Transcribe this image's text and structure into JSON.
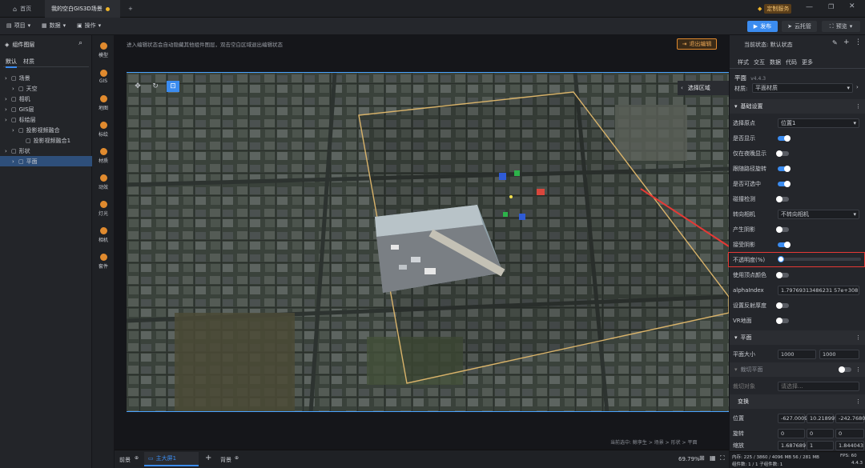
{
  "titlebar": {
    "home_tab": "首页",
    "doc_tab": "我的空白GIS3D场景",
    "custom_service": "定制服务"
  },
  "menubar": {
    "project": "项目",
    "data": "数据",
    "ops": "操作",
    "publish": "发布",
    "cloud": "云托管",
    "preview": "预览"
  },
  "left": {
    "title": "组件图层",
    "tab_default": "默认",
    "tab_material": "材质",
    "tree": [
      {
        "label": "场景",
        "depth": 0
      },
      {
        "label": "天空",
        "depth": 1
      },
      {
        "label": "相机",
        "depth": 0
      },
      {
        "label": "GIS层",
        "depth": 0
      },
      {
        "label": "标绘层",
        "depth": 0
      },
      {
        "label": "投影视频融合",
        "depth": 1
      },
      {
        "label": "投影视频融合1",
        "depth": 2
      },
      {
        "label": "形状",
        "depth": 0
      },
      {
        "label": "平面",
        "depth": 1
      }
    ]
  },
  "tools": [
    "模型",
    "GIS",
    "地图",
    "标绘",
    "材质",
    "动效",
    "灯光",
    "相机",
    "套件"
  ],
  "center": {
    "hint": "进入编辑状态会自动隐藏其他组件图层，双击空白区域退出编辑状态",
    "exit_edit": "退出编辑",
    "select_area": "选择区域",
    "breadcrumb": "当前选中: 鲸孪生 > 场景 > 形状 > 平面"
  },
  "right": {
    "status_label": "当前状态:",
    "status_value": "默认状态",
    "tabs": [
      "样式",
      "交互",
      "数据",
      "代码",
      "更多"
    ],
    "comp_name": "平面",
    "version": "v4.4.3",
    "material_label": "材质:",
    "material_value": "平面材质",
    "basic_section": "基础设置",
    "rows": [
      {
        "label": "选择原点",
        "type": "select",
        "value": "位置1"
      },
      {
        "label": "是否显示",
        "type": "toggle",
        "on": true
      },
      {
        "label": "仅在夜晚显示",
        "type": "toggle",
        "on": false
      },
      {
        "label": "跟随路径旋转",
        "type": "toggle",
        "on": true
      },
      {
        "label": "是否可选中",
        "type": "toggle",
        "on": true
      },
      {
        "label": "碰撞检测",
        "type": "toggle",
        "on": false
      },
      {
        "label": "转向相机",
        "type": "select",
        "value": "不转向相机"
      },
      {
        "label": "产生阴影",
        "type": "toggle",
        "on": false
      },
      {
        "label": "接受阴影",
        "type": "toggle",
        "on": true
      },
      {
        "label": "不透明度(%)",
        "type": "slider",
        "value": 0
      },
      {
        "label": "使用顶点颜色",
        "type": "toggle",
        "on": false
      },
      {
        "label": "alphaIndex",
        "type": "input",
        "value": "1.79769313486231 57e+308"
      },
      {
        "label": "设置反射厚度",
        "type": "toggle",
        "on": false
      },
      {
        "label": "VR地面",
        "type": "toggle",
        "on": false
      }
    ],
    "plane_section": "平面",
    "plane_size_label": "平面大小",
    "plane_w": "1000",
    "plane_h": "1000",
    "clip_section": "裁切平面",
    "clip_obj_label": "裁切对象",
    "clip_obj_value": "请选择...",
    "transform_section": "变换",
    "pos_label": "位置",
    "pos": [
      "-627.0009",
      "10.218995",
      "-242.7680"
    ],
    "rot_label": "旋转",
    "rot": [
      "0",
      "0",
      "0"
    ],
    "scale_label": "缩放",
    "scale": [
      "1.687689",
      "1",
      "1.844043"
    ]
  },
  "status": {
    "tab_front": "前景",
    "tab_main": "主大屏1",
    "tab_back": "背景",
    "zoom": "69.79%",
    "mem": "内存: 225 / 3860 / 4096 MB  56 / 281 MB",
    "fps": "FPS: 60",
    "count": "组件数: 1 / 1   子组件数: 1",
    "version": "4.4.3"
  },
  "colors": {
    "accent": "#3b8cf0",
    "highlight": "#e53935",
    "orange": "#e08a2e"
  }
}
